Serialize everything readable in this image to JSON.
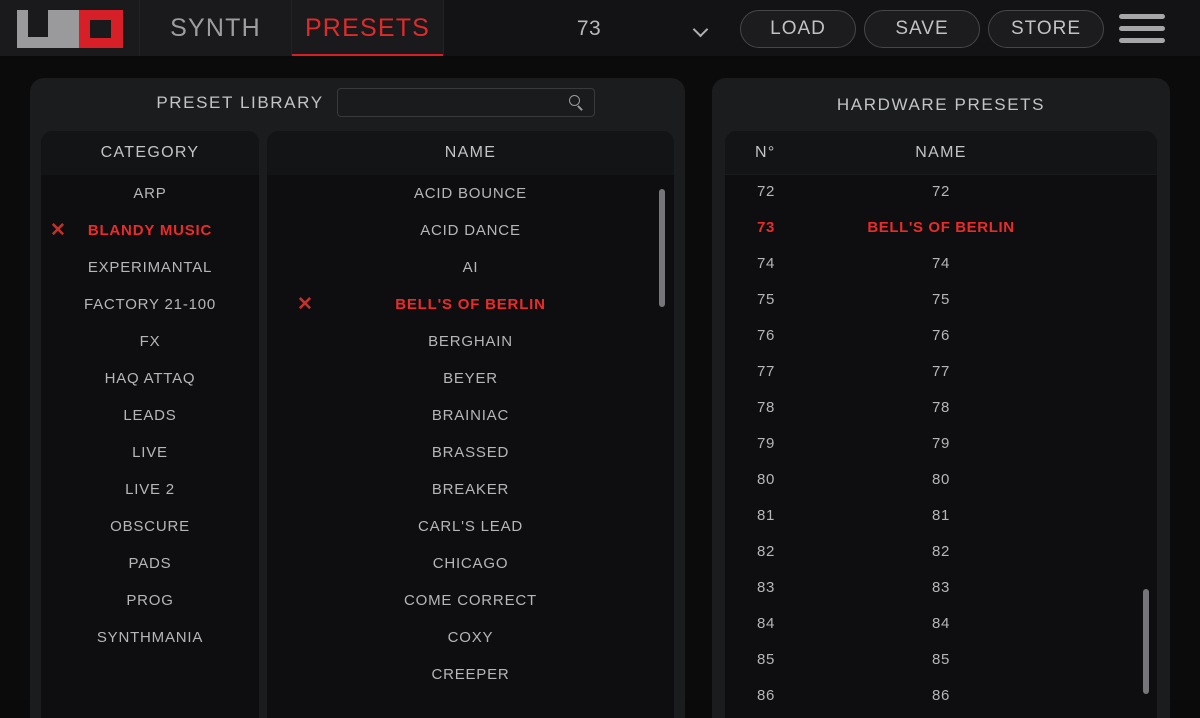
{
  "app": {
    "logo_alt": "UNO",
    "accent_red": "#d61f26",
    "text_gray": "#b6b6b8"
  },
  "topbar": {
    "tabs": [
      {
        "label": "SYNTH",
        "active": false
      },
      {
        "label": "PRESETS",
        "active": true
      }
    ],
    "preset_selector": {
      "value": "73",
      "chevron": "chevron-down-icon"
    },
    "buttons": [
      {
        "label": "LOAD"
      },
      {
        "label": "SAVE"
      },
      {
        "label": "STORE"
      }
    ],
    "menu_icon": "hamburger-menu-icon"
  },
  "library": {
    "title": "PRESET LIBRARY",
    "search": {
      "value": "",
      "placeholder": "",
      "icon": "search-icon"
    },
    "category": {
      "header": "CATEGORY",
      "items": [
        {
          "label": "ARP",
          "selected": false
        },
        {
          "label": "BLANDY MUSIC",
          "selected": true
        },
        {
          "label": "EXPERIMANTAL",
          "selected": false
        },
        {
          "label": "FACTORY 21-100",
          "selected": false
        },
        {
          "label": "FX",
          "selected": false
        },
        {
          "label": "HAQ ATTAQ",
          "selected": false
        },
        {
          "label": "LEADS",
          "selected": false
        },
        {
          "label": "LIVE",
          "selected": false
        },
        {
          "label": "LIVE 2",
          "selected": false
        },
        {
          "label": "OBSCURE",
          "selected": false
        },
        {
          "label": "PADS",
          "selected": false
        },
        {
          "label": "PROG",
          "selected": false
        },
        {
          "label": "SYNTHMANIA",
          "selected": false
        }
      ]
    },
    "name": {
      "header": "NAME",
      "items": [
        {
          "label": "ACID BOUNCE",
          "selected": false
        },
        {
          "label": "ACID DANCE",
          "selected": false
        },
        {
          "label": "AI",
          "selected": false
        },
        {
          "label": "BELL'S OF BERLIN",
          "selected": true
        },
        {
          "label": "BERGHAIN",
          "selected": false
        },
        {
          "label": "BEYER",
          "selected": false
        },
        {
          "label": "BRAINIAC",
          "selected": false
        },
        {
          "label": "BRASSED",
          "selected": false
        },
        {
          "label": "BREAKER",
          "selected": false
        },
        {
          "label": "CARL'S LEAD",
          "selected": false
        },
        {
          "label": "CHICAGO",
          "selected": false
        },
        {
          "label": "COME CORRECT",
          "selected": false
        },
        {
          "label": "COXY",
          "selected": false
        },
        {
          "label": "CREEPER",
          "selected": false
        }
      ]
    }
  },
  "hardware": {
    "title": "HARDWARE PRESETS",
    "columns": {
      "number": "N°",
      "name": "NAME"
    },
    "rows": [
      {
        "no": "72",
        "name": "72",
        "selected": false
      },
      {
        "no": "73",
        "name": "BELL'S OF BERLIN",
        "selected": true
      },
      {
        "no": "74",
        "name": "74",
        "selected": false
      },
      {
        "no": "75",
        "name": "75",
        "selected": false
      },
      {
        "no": "76",
        "name": "76",
        "selected": false
      },
      {
        "no": "77",
        "name": "77",
        "selected": false
      },
      {
        "no": "78",
        "name": "78",
        "selected": false
      },
      {
        "no": "79",
        "name": "79",
        "selected": false
      },
      {
        "no": "80",
        "name": "80",
        "selected": false
      },
      {
        "no": "81",
        "name": "81",
        "selected": false
      },
      {
        "no": "82",
        "name": "82",
        "selected": false
      },
      {
        "no": "83",
        "name": "83",
        "selected": false
      },
      {
        "no": "84",
        "name": "84",
        "selected": false
      },
      {
        "no": "85",
        "name": "85",
        "selected": false
      },
      {
        "no": "86",
        "name": "86",
        "selected": false
      }
    ]
  }
}
